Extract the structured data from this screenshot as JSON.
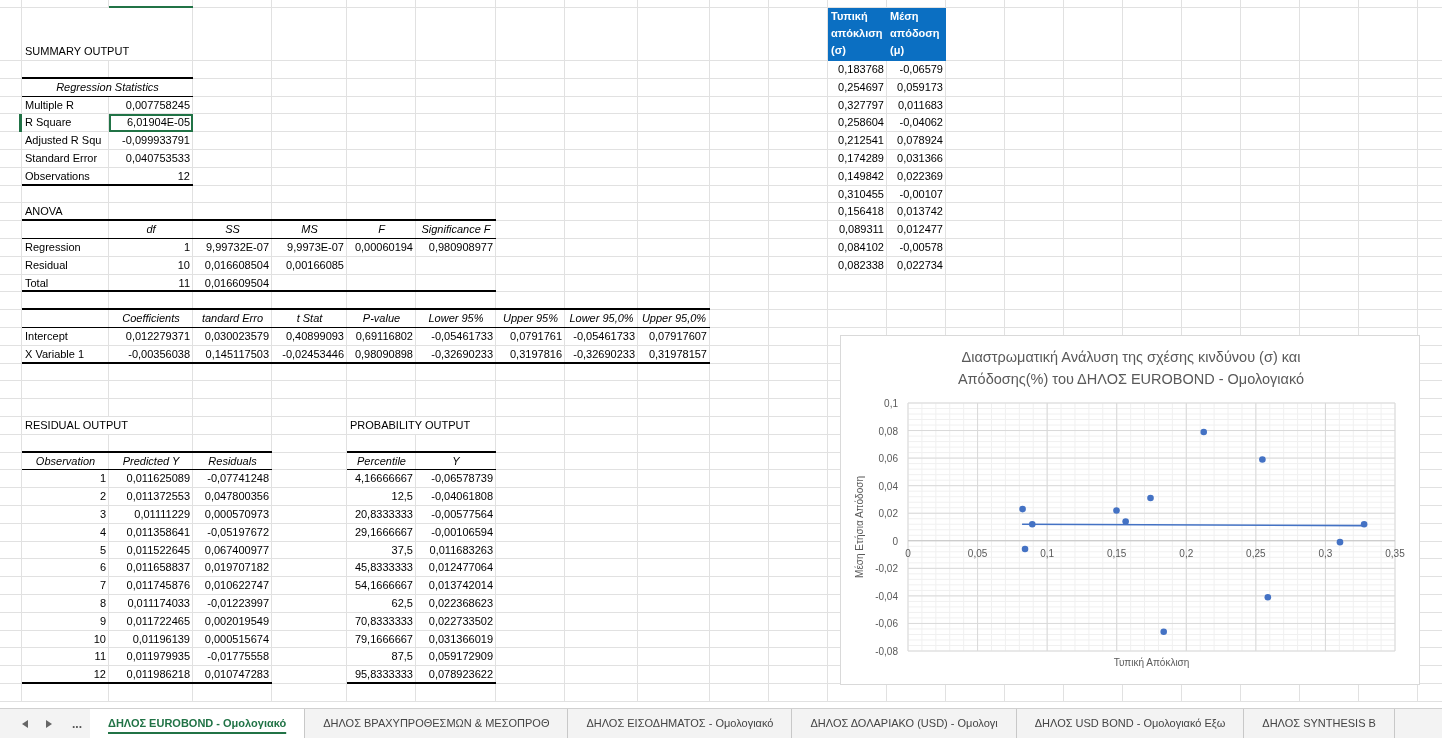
{
  "summary_title": "SUMMARY OUTPUT",
  "regression_statistics": {
    "title": "Regression Statistics",
    "rows": [
      {
        "label": "Multiple R",
        "value": "0,007758245",
        "selected": false
      },
      {
        "label": "R Square",
        "value": "6,01904E-05",
        "selected": true
      },
      {
        "label": "Adjusted R Squ",
        "value": "-0,099933791",
        "selected": false
      },
      {
        "label": "Standard Error",
        "value": "0,040753533",
        "selected": false
      },
      {
        "label": "Observations",
        "value": "12",
        "selected": false
      }
    ]
  },
  "anova": {
    "title": "ANOVA",
    "columns": [
      "df",
      "SS",
      "MS",
      "F",
      "Significance F"
    ],
    "rows": [
      {
        "label": "Regression",
        "cells": [
          "1",
          "9,99732E-07",
          "9,9973E-07",
          "0,00060194",
          "0,980908977"
        ]
      },
      {
        "label": "Residual",
        "cells": [
          "10",
          "0,016608504",
          "0,00166085"
        ]
      },
      {
        "label": "Total",
        "cells": [
          "11",
          "0,016609504"
        ]
      }
    ]
  },
  "coefficients": {
    "columns": [
      "Coefficients",
      "tandard Erro",
      "t Stat",
      "P-value",
      "Lower 95%",
      "Upper 95%",
      "Lower 95,0%",
      "Upper 95,0%"
    ],
    "rows": [
      {
        "label": "Intercept",
        "cells": [
          "0,012279371",
          "0,030023579",
          "0,40899093",
          "0,69116802",
          "-0,05461733",
          "0,0791761",
          "-0,05461733",
          "0,07917607"
        ]
      },
      {
        "label": "X Variable 1",
        "cells": [
          "-0,00356038",
          "0,145117503",
          "-0,02453446",
          "0,98090898",
          "-0,32690233",
          "0,3197816",
          "-0,32690233",
          "0,31978157"
        ]
      }
    ]
  },
  "residual_output": {
    "title": "RESIDUAL OUTPUT",
    "columns": [
      "Observation",
      "Predicted Y",
      "Residuals"
    ],
    "rows": [
      [
        "1",
        "0,011625089",
        "-0,07741248"
      ],
      [
        "2",
        "0,011372553",
        "0,047800356"
      ],
      [
        "3",
        "0,01111229",
        "0,000570973"
      ],
      [
        "4",
        "0,011358641",
        "-0,05197672"
      ],
      [
        "5",
        "0,011522645",
        "0,067400977"
      ],
      [
        "6",
        "0,011658837",
        "0,019707182"
      ],
      [
        "7",
        "0,011745876",
        "0,010622747"
      ],
      [
        "8",
        "0,011174033",
        "-0,01223997"
      ],
      [
        "9",
        "0,011722465",
        "0,002019549"
      ],
      [
        "10",
        "0,01196139",
        "0,000515674"
      ],
      [
        "11",
        "0,011979935",
        "-0,01775558"
      ],
      [
        "12",
        "0,011986218",
        "0,010747283"
      ]
    ]
  },
  "probability_output": {
    "title": "PROBABILITY OUTPUT",
    "columns": [
      "Percentile",
      "Y"
    ],
    "rows": [
      [
        "4,16666667",
        "-0,06578739"
      ],
      [
        "12,5",
        "-0,04061808"
      ],
      [
        "20,8333333",
        "-0,00577564"
      ],
      [
        "29,1666667",
        "-0,00106594"
      ],
      [
        "37,5",
        "0,011683263"
      ],
      [
        "45,8333333",
        "0,012477064"
      ],
      [
        "54,1666667",
        "0,013742014"
      ],
      [
        "62,5",
        "0,022368623"
      ],
      [
        "70,8333333",
        "0,022733502"
      ],
      [
        "79,1666667",
        "0,031366019"
      ],
      [
        "87,5",
        "0,059172909"
      ],
      [
        "95,8333333",
        "0,078923622"
      ]
    ]
  },
  "risk_return_table": {
    "columns": [
      "Τυπική απόκλιση (σ)",
      "Μέση απόδοση (μ)"
    ],
    "rows": [
      [
        "0,183768",
        "-0,06579"
      ],
      [
        "0,254697",
        "0,059173"
      ],
      [
        "0,327797",
        "0,011683"
      ],
      [
        "0,258604",
        "-0,04062"
      ],
      [
        "0,212541",
        "0,078924"
      ],
      [
        "0,174289",
        "0,031366"
      ],
      [
        "0,149842",
        "0,022369"
      ],
      [
        "0,310455",
        "-0,00107"
      ],
      [
        "0,156418",
        "0,013742"
      ],
      [
        "0,089311",
        "0,012477"
      ],
      [
        "0,084102",
        "-0,00578"
      ],
      [
        "0,082338",
        "0,022734"
      ]
    ]
  },
  "chart": {
    "chart_data": {
      "type": "scatter",
      "title": "Διαστρωματική Ανάλυση της σχέσης κινδύνου (σ) και Απόδοσης(%) του ΔΗΛΟΣ EUROBOND - Ομολογιακό",
      "xlabel": "Τυπική Απόκλιση",
      "ylabel": "Μέση Ετήσια Απόδοση",
      "x": [
        0.183768,
        0.254697,
        0.327797,
        0.258604,
        0.212541,
        0.174289,
        0.149842,
        0.310455,
        0.156418,
        0.089311,
        0.084102,
        0.082338
      ],
      "series": [
        {
          "type": "scatter",
          "color": "#4472c4",
          "values": [
            -0.066,
            0.059,
            0.012,
            -0.041,
            0.079,
            0.031,
            0.022,
            -0.001,
            0.014,
            0.012,
            -0.006,
            0.023
          ]
        },
        {
          "type": "line",
          "color": "#4472c4",
          "x": [
            0.082,
            0.328
          ],
          "values": [
            0.012,
            0.011
          ]
        }
      ],
      "grid": true,
      "xlim": [
        0,
        0.35
      ],
      "ylim": [
        -0.08,
        0.1
      ],
      "xticks": [
        {
          "value": 0,
          "label": "0"
        },
        {
          "value": 0.05,
          "label": "0,05"
        },
        {
          "value": 0.1,
          "label": "0,1"
        },
        {
          "value": 0.15,
          "label": "0,15"
        },
        {
          "value": 0.2,
          "label": "0,2"
        },
        {
          "value": 0.25,
          "label": "0,25"
        },
        {
          "value": 0.3,
          "label": "0,3"
        },
        {
          "value": 0.35,
          "label": "0,35"
        }
      ],
      "yticks": [
        {
          "value": -0.08,
          "label": "-0,08"
        },
        {
          "value": -0.06,
          "label": "-0,06"
        },
        {
          "value": -0.04,
          "label": "-0,04"
        },
        {
          "value": -0.02,
          "label": "-0,02"
        },
        {
          "value": 0,
          "label": "0"
        },
        {
          "value": 0.02,
          "label": "0,02"
        },
        {
          "value": 0.04,
          "label": "0,04"
        },
        {
          "value": 0.06,
          "label": "0,06"
        },
        {
          "value": 0.08,
          "label": "0,08"
        },
        {
          "value": 0.1,
          "label": "0,1"
        }
      ]
    }
  },
  "sheet_nav": {
    "more": "..."
  },
  "sheet_tabs": [
    {
      "label": "ΔΗΛΟΣ EUROBOND - Ομολογιακό",
      "selected": true
    },
    {
      "label": "ΔΗΛΟΣ ΒΡΑΧΥΠΡΟΘΕΣΜΩΝ & ΜΕΣΟΠΡΟΘ",
      "selected": false
    },
    {
      "label": "ΔΗΛΟΣ ΕΙΣΟΔΗΜΑΤΟΣ - Ομολογιακό",
      "selected": false
    },
    {
      "label": "ΔΗΛΟΣ ΔΟΛΑΡΙΑΚΟ (USD) - Ομολογι",
      "selected": false
    },
    {
      "label": "ΔΗΛΟΣ USD BOND - Ομολογιακό Εξω",
      "selected": false
    },
    {
      "label": "ΔΗΛΟΣ SYNTHESIS B",
      "selected": false
    }
  ]
}
